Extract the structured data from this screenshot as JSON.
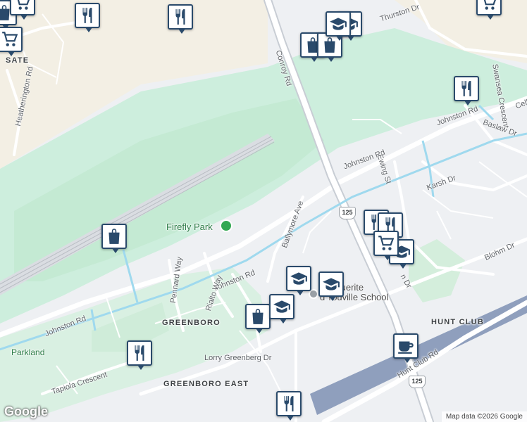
{
  "map": {
    "districts": [
      "HUNT CLUB",
      "GREENBORO",
      "GREENBORO EAST"
    ],
    "district_partial": "SATE",
    "park_name": "Firefly Park",
    "school_name": "Marguerite\nd'Youville School",
    "area_labels": [
      "Parkland"
    ],
    "streets": [
      "Conroy Rd",
      "Thurston Dr",
      "Johnston Rd",
      "Johnston Rd",
      "Johnston Rd",
      "Johnston Rd",
      "Ballymore Ave",
      "Ewing St",
      "Karsh Dr",
      "Blohm Dr",
      "Rialto Way",
      "Pennard Way",
      "Lorry Greenberg Dr",
      "Tapiola Crescent",
      "Hunt Club Rd",
      "Heatherington Rd",
      "Swansea Crescent",
      "Baslaw Dr",
      "Cell",
      "n Dr"
    ],
    "highway_shields": [
      "125",
      "125"
    ],
    "pins": [
      {
        "icon": "fork-knife-icon"
      },
      {
        "icon": "fork-knife-icon"
      },
      {
        "icon": "fork-knife-icon"
      },
      {
        "icon": "fork-knife-icon"
      },
      {
        "icon": "fork-knife-icon"
      },
      {
        "icon": "fork-knife-icon"
      },
      {
        "icon": "fork-knife-icon"
      },
      {
        "icon": "shopping-bag-icon"
      },
      {
        "icon": "shopping-bag-icon"
      },
      {
        "icon": "shopping-bag-icon"
      },
      {
        "icon": "shopping-bag-icon"
      },
      {
        "icon": "graduation-cap-icon"
      },
      {
        "icon": "graduation-cap-icon"
      },
      {
        "icon": "graduation-cap-icon"
      },
      {
        "icon": "graduation-cap-icon"
      },
      {
        "icon": "graduation-cap-icon"
      },
      {
        "icon": "graduation-cap-icon"
      },
      {
        "icon": "shopping-cart-icon"
      },
      {
        "icon": "shopping-cart-icon"
      },
      {
        "icon": "shopping-cart-icon"
      },
      {
        "icon": "shopping-cart-icon"
      },
      {
        "icon": "coffee-cup-icon"
      }
    ],
    "logo": "Google",
    "attribution": "Map data ©2026 Google"
  }
}
